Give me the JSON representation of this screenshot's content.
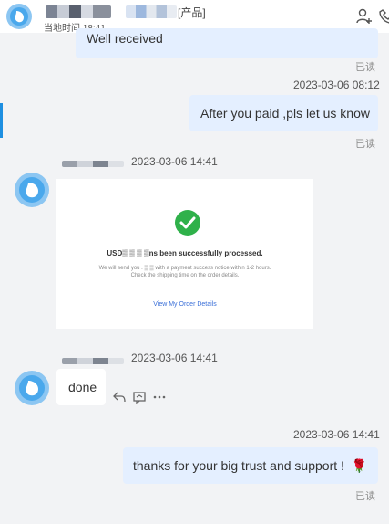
{
  "header": {
    "title_suffix": "[产品]",
    "local_time": "当地时间 18:41",
    "icons": [
      "add-user-icon",
      "phone-icon",
      "avatar-icon"
    ]
  },
  "messages": [
    {
      "direction": "out",
      "text": "Well received",
      "read": "已读"
    },
    {
      "direction": "out",
      "timestamp": "2023-03-06 08:12",
      "text": "After you paid ,pls let us know",
      "read": "已读"
    },
    {
      "direction": "in",
      "timestamp": "2023-03-06 14:41",
      "card": {
        "title": "USD▒ ▒ ▒ ▒ns been successfully processed.",
        "line1": "We will send you . ▒ ▒ with a payment success notice within 1-2 hours.",
        "line2": "Check the shipping time on the order details.",
        "link": "View My Order Details"
      }
    },
    {
      "direction": "in",
      "timestamp": "2023-03-06 14:41",
      "text": "done",
      "actions": [
        "reply-icon",
        "quote-icon",
        "more-icon"
      ]
    },
    {
      "direction": "out",
      "timestamp": "2023-03-06 14:41",
      "text": "thanks for your big trust and support !",
      "emoji": "🌹",
      "read": "已读"
    }
  ],
  "colors": {
    "outgoing_bubble": "#e4efff",
    "incoming_bubble": "#ffffff",
    "background": "#f2f3f5",
    "accent": "#1e8fe1",
    "success": "#2fb14a",
    "link": "#3a6fd8"
  }
}
